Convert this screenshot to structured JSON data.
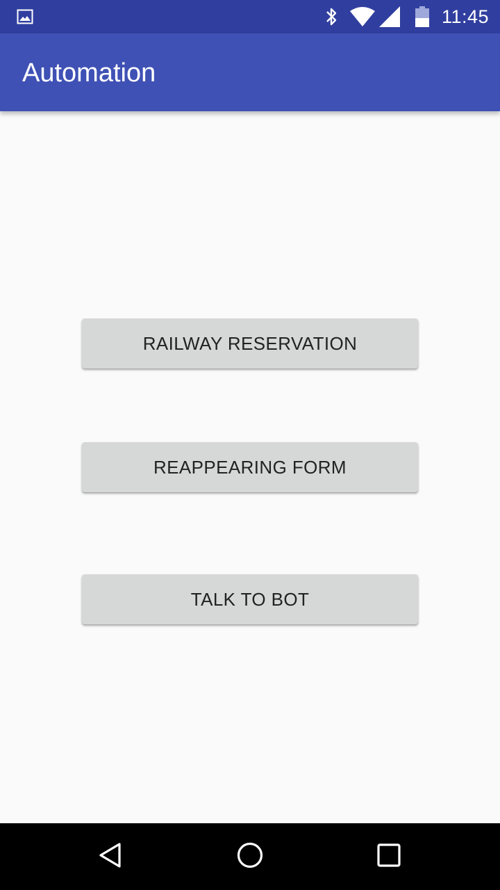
{
  "status_bar": {
    "time": "11:45",
    "icons": [
      "image-notification-icon",
      "bluetooth-icon",
      "wifi-icon",
      "cell-signal-icon",
      "battery-icon"
    ],
    "background": "#303f9f"
  },
  "app_bar": {
    "title": "Automation",
    "background": "#3f51b5"
  },
  "main": {
    "buttons": [
      {
        "label": "RAILWAY RESERVATION"
      },
      {
        "label": "REAPPEARING FORM"
      },
      {
        "label": "TALK TO BOT"
      }
    ],
    "button_color": "#d6d7d7"
  },
  "nav_bar": {
    "icons": [
      "back-icon",
      "home-icon",
      "recents-icon"
    ],
    "background": "#000000"
  }
}
